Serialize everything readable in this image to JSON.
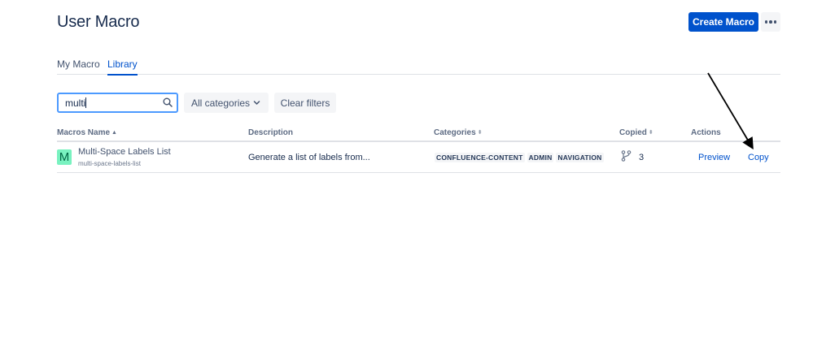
{
  "header": {
    "title": "User Macro",
    "create_label": "Create Macro",
    "more_icon": "more-dots-icon"
  },
  "tabs": [
    {
      "label": "My Macro",
      "active": false
    },
    {
      "label": "Library",
      "active": true
    }
  ],
  "filters": {
    "search_value": "multi",
    "search_icon": "search-icon",
    "category_label": "All categories",
    "clear_label": "Clear filters"
  },
  "table": {
    "columns": [
      "Macros Name",
      "Description",
      "Categories",
      "Copied",
      "Actions"
    ],
    "rows": [
      {
        "icon_letter": "M",
        "name": "Multi-Space Labels List",
        "key": "multi-space-labels-list",
        "description": "Generate a list of labels from...",
        "categories": [
          "CONFLUENCE-CONTENT",
          "ADMIN",
          "NAVIGATION"
        ],
        "copied": "3",
        "actions": [
          "Preview",
          "Copy"
        ]
      }
    ]
  },
  "colors": {
    "primary": "#0052CC",
    "macro_icon_bg": "#79F2C0",
    "text": "#172B4D"
  }
}
